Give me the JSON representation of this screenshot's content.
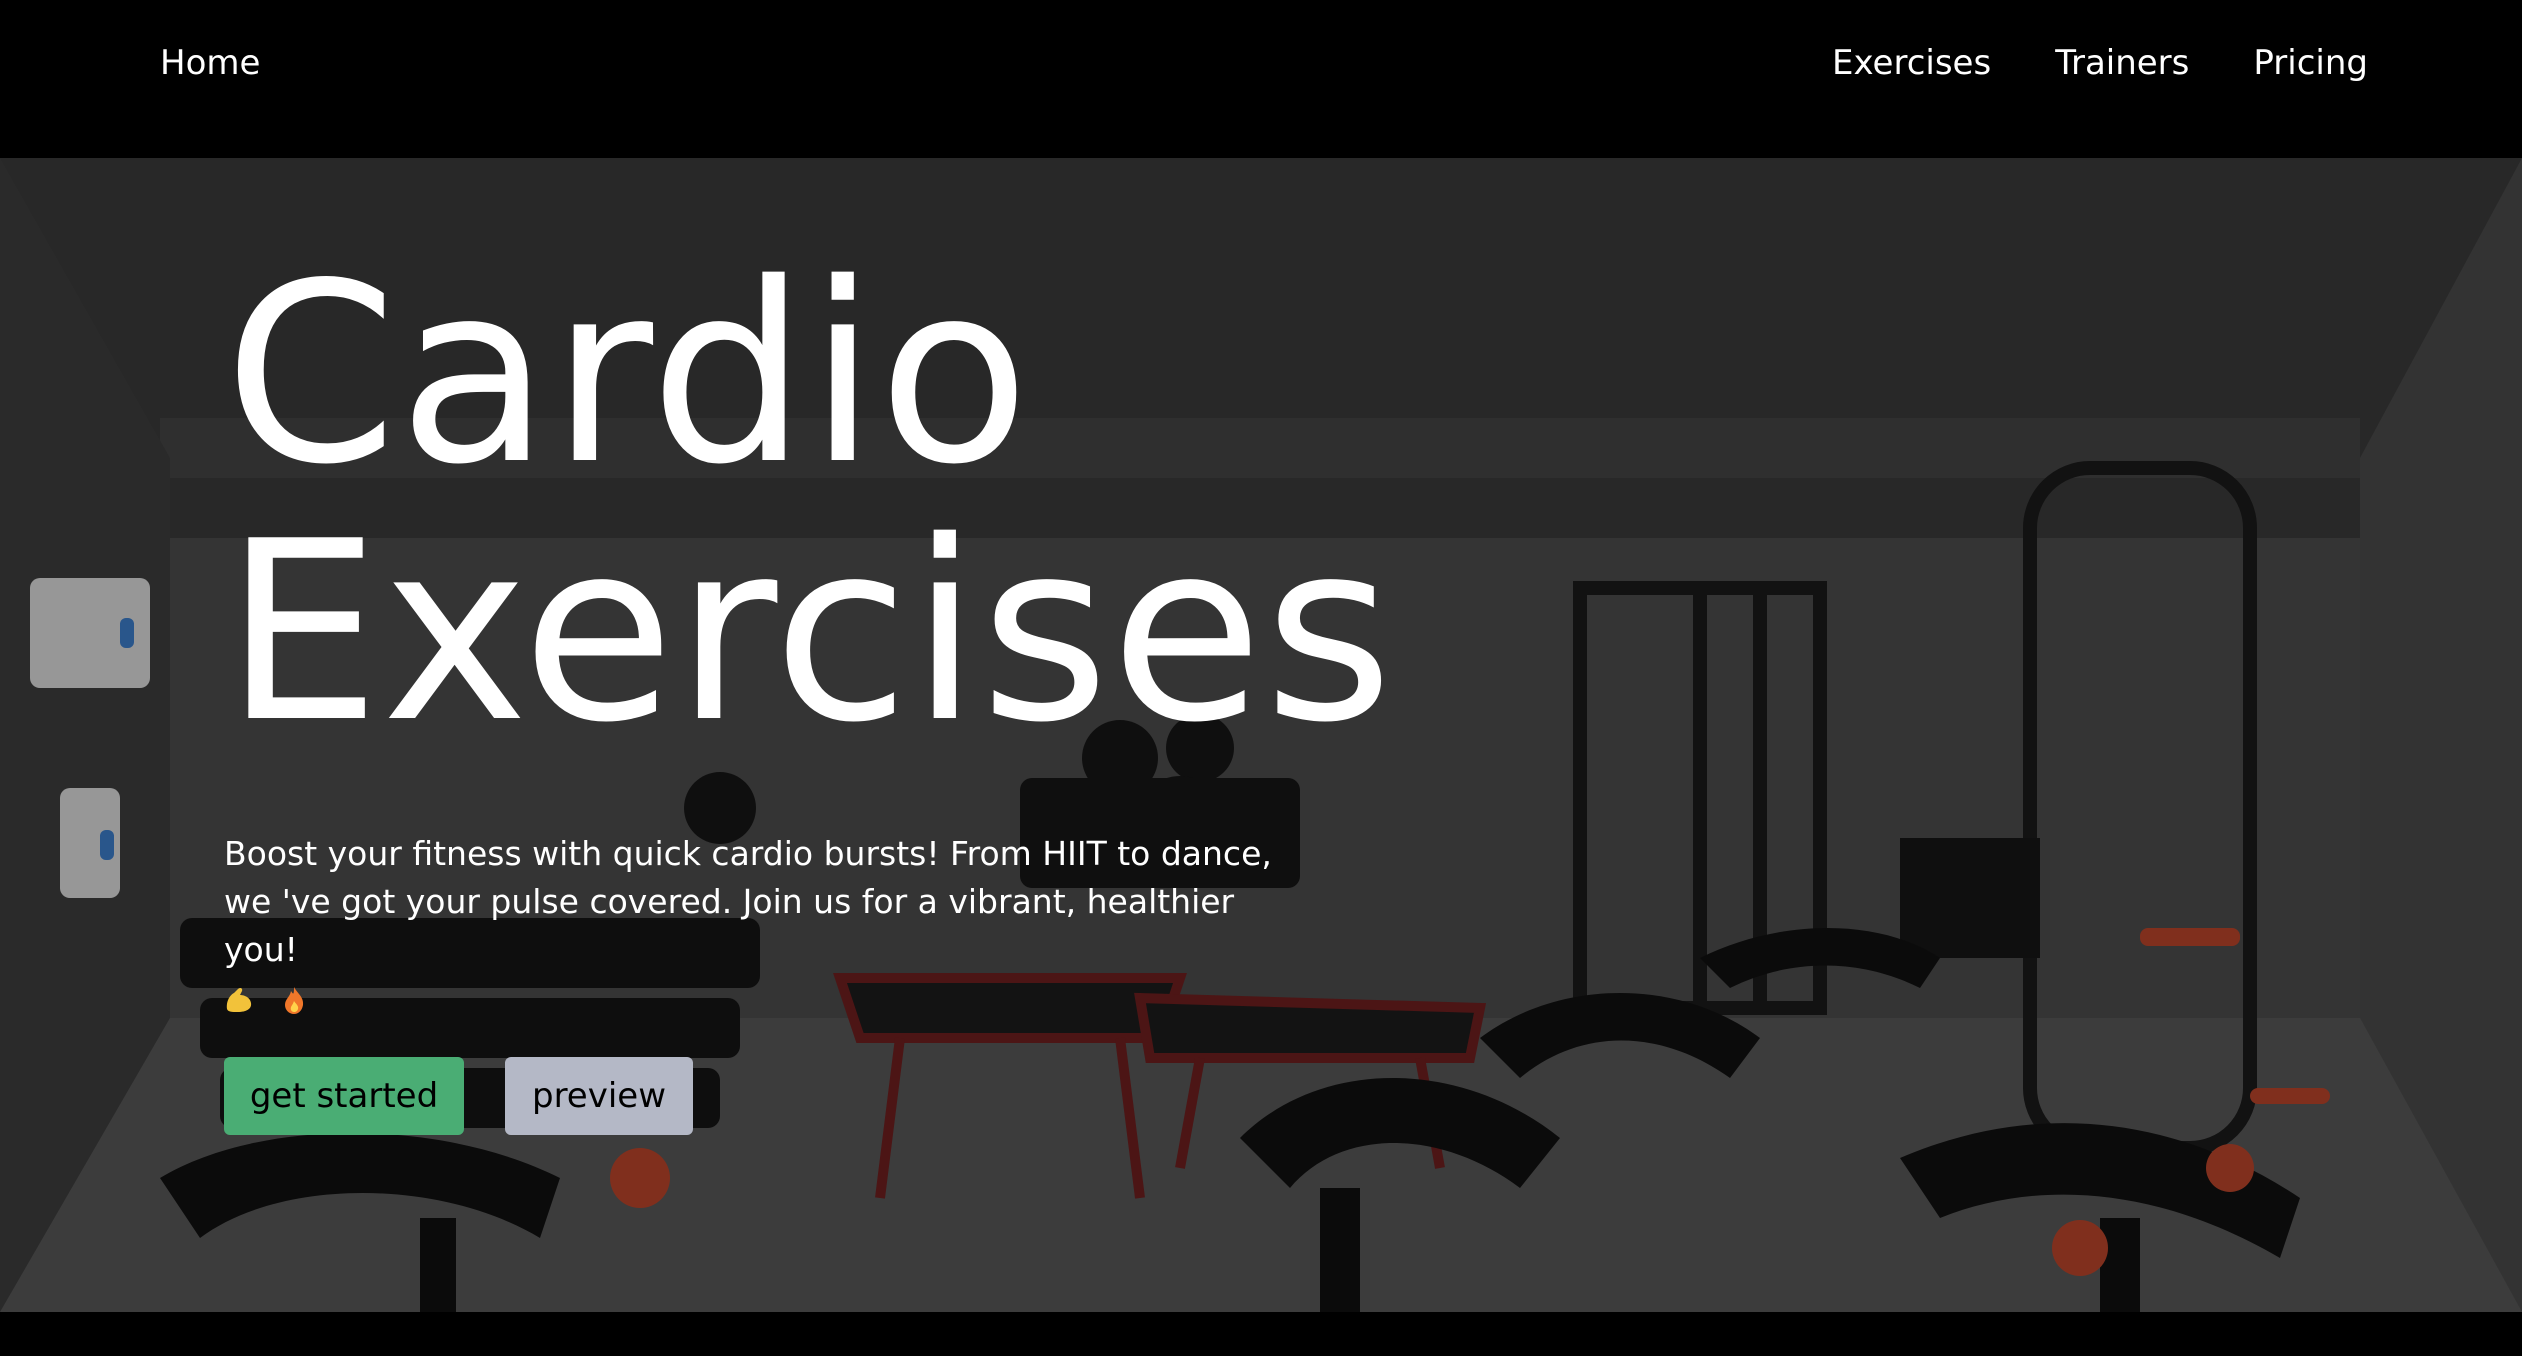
{
  "nav": {
    "home": "Home",
    "links": [
      "Exercises",
      "Trainers",
      "Pricing"
    ]
  },
  "hero": {
    "title_line1": "Cardio",
    "title_line2": "Exercises",
    "description_line1": "Boost your fitness with quick cardio bursts! From HIIT to dance,",
    "description_line2": "we 've got your pulse covered. Join us for a vibrant, healthier you!",
    "emojis": [
      "flexed-biceps-emoji",
      "fire-emoji"
    ],
    "background_image": "gym-interior-with-exercise-bikes"
  },
  "buttons": {
    "get_started": "get started",
    "preview": "preview"
  },
  "colors": {
    "nav_background": "#000000",
    "text": "#ffffff",
    "get_started_bg": "#4aad74",
    "preview_bg": "#b4b8c6"
  }
}
